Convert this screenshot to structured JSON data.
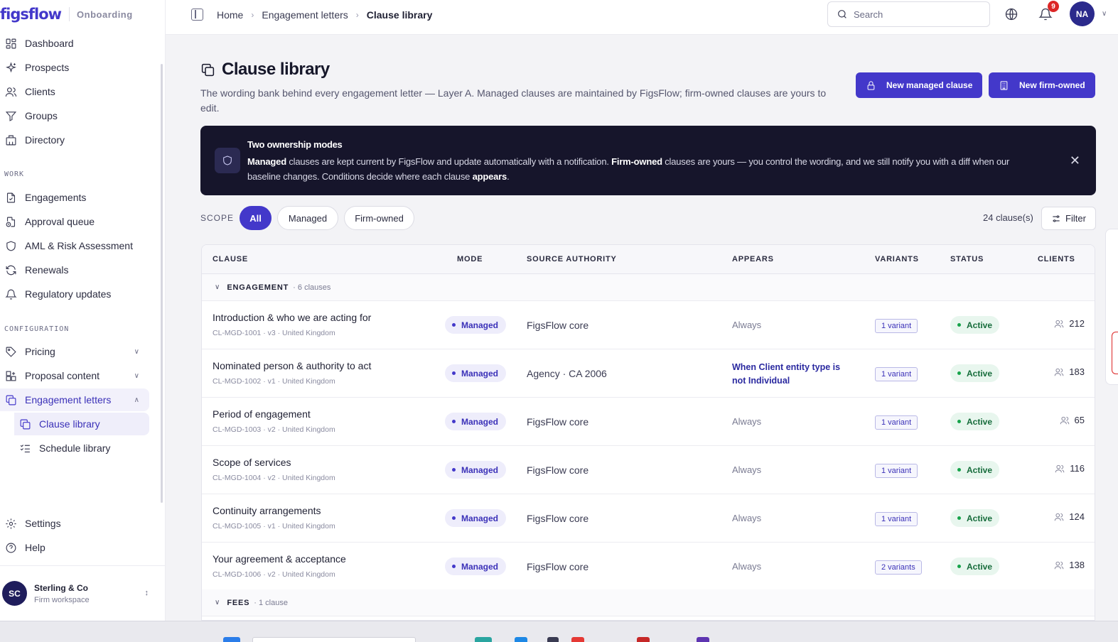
{
  "brand": {
    "logo": "figsflow",
    "section": "Onboarding"
  },
  "sidebar": {
    "items": [
      {
        "label": "Dashboard",
        "icon": "dashboard-icon"
      },
      {
        "label": "Prospects",
        "icon": "sparkles-icon"
      },
      {
        "label": "Clients",
        "icon": "users-icon"
      },
      {
        "label": "Groups",
        "icon": "filter-icon"
      },
      {
        "label": "Directory",
        "icon": "building-icon"
      }
    ],
    "work_label": "WORK",
    "work_items": [
      {
        "label": "Engagements",
        "icon": "file-check-icon"
      },
      {
        "label": "Approval queue",
        "icon": "file-clock-icon"
      },
      {
        "label": "AML & Risk Assessment",
        "icon": "shield-icon"
      },
      {
        "label": "Renewals",
        "icon": "refresh-icon"
      },
      {
        "label": "Regulatory updates",
        "icon": "bell-icon"
      }
    ],
    "config_label": "CONFIGURATION",
    "config_items": [
      {
        "label": "Pricing",
        "icon": "tag-icon"
      },
      {
        "label": "Proposal content",
        "icon": "blocks-icon"
      },
      {
        "label": "Engagement letters",
        "icon": "copy-icon"
      }
    ],
    "sub_items": [
      {
        "label": "Clause library",
        "icon": "copy-icon"
      },
      {
        "label": "Schedule library",
        "icon": "list-checks-icon"
      }
    ],
    "bottom_items": [
      {
        "label": "Settings",
        "icon": "gear-icon"
      },
      {
        "label": "Help",
        "icon": "help-icon"
      }
    ],
    "workspace": {
      "initials": "SC",
      "name": "Sterling & Co",
      "subtitle": "Firm workspace"
    }
  },
  "topbar": {
    "breadcrumbs": [
      "Home",
      "Engagement letters",
      "Clause library"
    ],
    "search_placeholder": "Search",
    "notifications": "9",
    "user_initials": "NA"
  },
  "page": {
    "title": "Clause library",
    "description": "The wording bank behind every engagement letter — Layer A. Managed clauses are maintained by FigsFlow; firm-owned clauses are yours to edit.",
    "btn_managed": "New managed clause",
    "btn_firm": "New firm-owned"
  },
  "banner": {
    "title": "Two ownership modes",
    "t1": "Managed",
    "t2": " clauses are kept current by FigsFlow and update automatically with a notification. ",
    "t3": "Firm-owned",
    "t4": " clauses are yours — you control the wording, and we still notify you with a diff when our baseline changes. Conditions decide where each clause ",
    "t5": "appears",
    "t6": "."
  },
  "scope": {
    "label": "SCOPE",
    "options": [
      "All",
      "Managed",
      "Firm-owned"
    ],
    "selected": "All",
    "count": "24 clause(s)",
    "filter_label": "Filter"
  },
  "table": {
    "headers": [
      "CLAUSE",
      "MODE",
      "SOURCE AUTHORITY",
      "APPEARS",
      "VARIANTS",
      "STATUS",
      "CLIENTS"
    ],
    "groups": [
      {
        "name": "ENGAGEMENT",
        "count": "· 6 clauses",
        "rows": [
          {
            "name": "Introduction & who we are acting for",
            "meta": "CL-MGD-1001 · v3 · United Kingdom",
            "mode": "Managed",
            "source": "FigsFlow core",
            "appears": "Always",
            "variants": "1 variant",
            "status": "Active",
            "clients": "212"
          },
          {
            "name": "Nominated person & authority to act",
            "meta": "CL-MGD-1002 · v1 · United Kingdom",
            "mode": "Managed",
            "source": "Agency · CA 2006",
            "appears": "When Client entity type is not Individual",
            "variants": "1 variant",
            "status": "Active",
            "clients": "183"
          },
          {
            "name": "Period of engagement",
            "meta": "CL-MGD-1003 · v2 · United Kingdom",
            "mode": "Managed",
            "source": "FigsFlow core",
            "appears": "Always",
            "variants": "1 variant",
            "status": "Active",
            "clients": "65"
          },
          {
            "name": "Scope of services",
            "meta": "CL-MGD-1004 · v2 · United Kingdom",
            "mode": "Managed",
            "source": "FigsFlow core",
            "appears": "Always",
            "variants": "1 variant",
            "status": "Active",
            "clients": "116"
          },
          {
            "name": "Continuity arrangements",
            "meta": "CL-MGD-1005 · v1 · United Kingdom",
            "mode": "Managed",
            "source": "FigsFlow core",
            "appears": "Always",
            "variants": "1 variant",
            "status": "Active",
            "clients": "124"
          },
          {
            "name": "Your agreement & acceptance",
            "meta": "CL-MGD-1006 · v2 · United Kingdom",
            "mode": "Managed",
            "source": "FigsFlow core",
            "appears": "Always",
            "variants": "2 variants",
            "status": "Active",
            "clients": "138"
          }
        ]
      },
      {
        "name": "FEES",
        "count": "· 1 clause",
        "rows": []
      }
    ]
  },
  "colors": {
    "accent": "#4338ca",
    "banner_bg": "#16152b",
    "active_green": "#16a34a",
    "badge_red": "#dc2626"
  }
}
